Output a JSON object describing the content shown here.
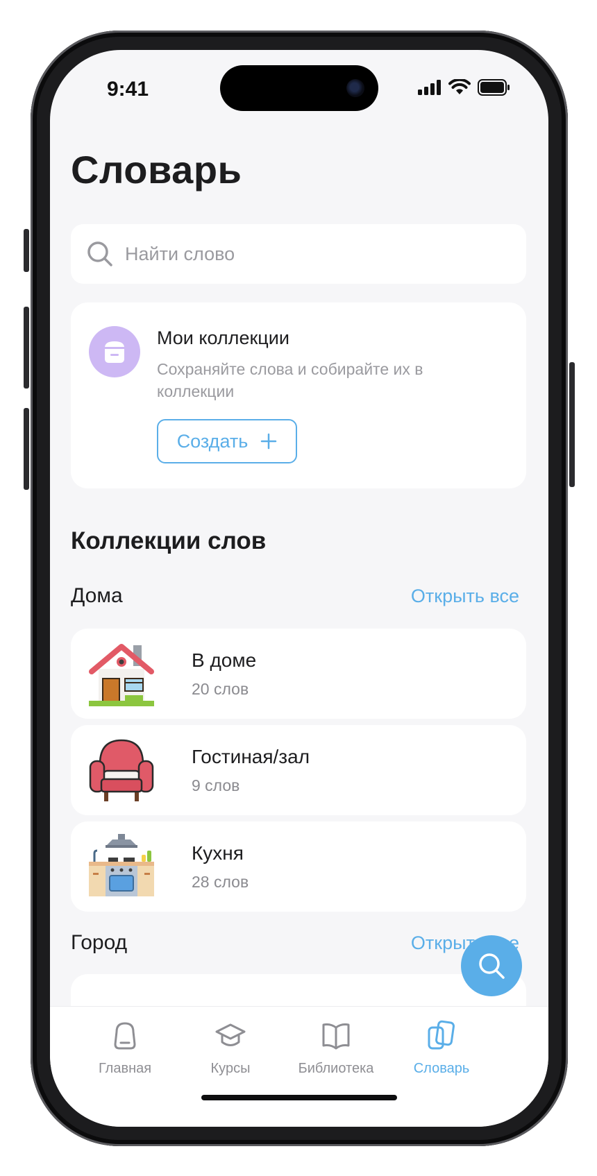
{
  "status": {
    "time": "9:41"
  },
  "header": {
    "title": "Словарь"
  },
  "search": {
    "placeholder": "Найти слово"
  },
  "collections_card": {
    "title": "Мои коллекции",
    "description": "Сохраняйте слова и собирайте их в коллекции",
    "create_label": "Создать"
  },
  "section": {
    "title": "Коллекции слов"
  },
  "groups": [
    {
      "title": "Дома",
      "open_all": "Открыть все",
      "items": [
        {
          "name": "В доме",
          "count": "20 слов",
          "icon": "house-icon"
        },
        {
          "name": "Гостиная/зал",
          "count": "9 слов",
          "icon": "armchair-icon"
        },
        {
          "name": "Кухня",
          "count": "28 слов",
          "icon": "kitchen-icon"
        }
      ]
    },
    {
      "title": "Город",
      "open_all": "Открыть все"
    }
  ],
  "tabbar": {
    "items": [
      {
        "label": "Главная",
        "icon": "home-icon"
      },
      {
        "label": "Курсы",
        "icon": "graduation-cap-icon"
      },
      {
        "label": "Библиотека",
        "icon": "book-icon"
      },
      {
        "label": "Словарь",
        "icon": "cards-icon",
        "active": true
      }
    ]
  },
  "colors": {
    "accent": "#5aaee8",
    "avatar": "#cdb8f4",
    "background": "#f6f6f8"
  }
}
